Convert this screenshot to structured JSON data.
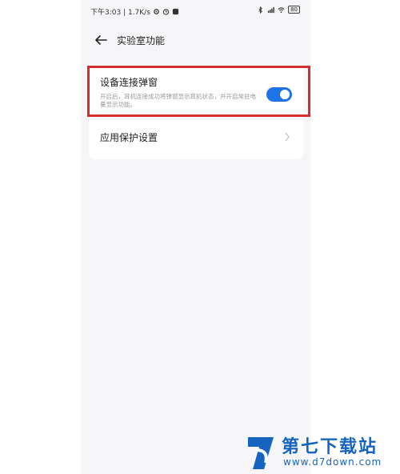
{
  "status_bar": {
    "time_speed": "下午3:03 | 1.7K/s",
    "battery": "80"
  },
  "header": {
    "title": "实验室功能"
  },
  "settings": {
    "popup": {
      "title": "设备连接弹窗",
      "description": "开启后，耳机连接成功将弹窗显示耳机状态，并开启常驻电量显示功能。",
      "enabled": true
    },
    "protect": {
      "label": "应用保护设置"
    }
  },
  "watermark": {
    "name": "第七下载站",
    "url": "www.d7down.com"
  },
  "colors": {
    "accent": "#1e73e6",
    "highlight": "#d32f2f",
    "watermark": "#1565c0"
  }
}
